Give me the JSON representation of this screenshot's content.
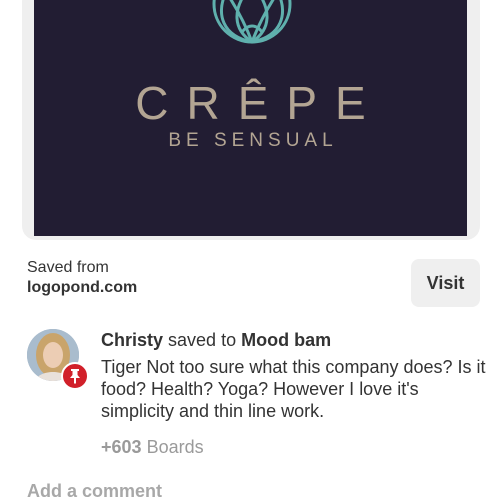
{
  "pin": {
    "image": {
      "brand_name": "CRÊPE",
      "tagline": "BE SENSUAL",
      "background_color": "#221d33",
      "logo_color": "#5fb0ad",
      "text_color": "#b3a593"
    },
    "saved_from_label": "Saved from",
    "source_domain": "logopond.com",
    "visit_label": "Visit"
  },
  "activity": {
    "user_name": "Christy",
    "action_text": "saved to",
    "board_name": "Mood bam",
    "description": "Tiger Not too sure what this company does? Is it food? Health? Yoga? However I love it's simplicity and thin line work.",
    "boards_count": "+603",
    "boards_label": "Boards",
    "badge_icon": "pushpin-icon",
    "badge_color": "#d1202a"
  },
  "comment": {
    "add_comment_label": "Add a comment"
  }
}
